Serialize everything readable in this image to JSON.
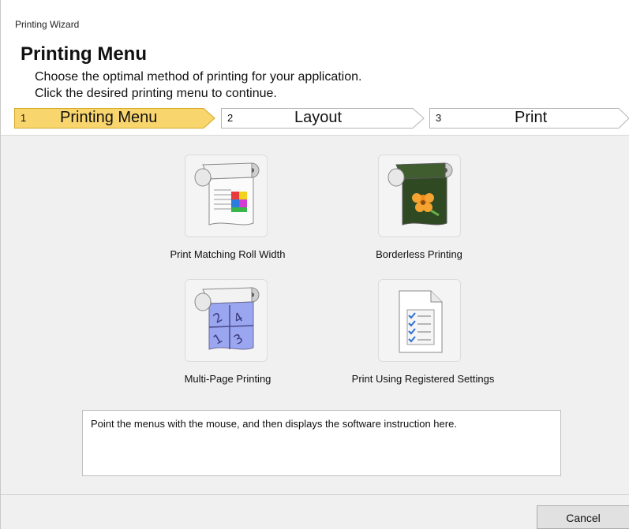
{
  "window": {
    "title": "Printing Wizard"
  },
  "header": {
    "heading": "Printing Menu",
    "desc_line1": "Choose the optimal method of printing for your application.",
    "desc_line2": "Click the desired printing menu to continue."
  },
  "steps": [
    {
      "number": "1",
      "label": "Printing Menu",
      "active": true
    },
    {
      "number": "2",
      "label": "Layout",
      "active": false
    },
    {
      "number": "3",
      "label": "Print",
      "active": false
    }
  ],
  "menu": [
    {
      "label": "Print Matching Roll Width",
      "icon": "roll-paper-color-icon"
    },
    {
      "label": "Borderless Printing",
      "icon": "roll-paper-borderless-icon"
    },
    {
      "label": "Multi-Page Printing",
      "icon": "roll-paper-multipage-icon"
    },
    {
      "label": "Print Using Registered Settings",
      "icon": "checklist-document-icon"
    }
  ],
  "info_text": "Point the menus with the mouse, and then displays the software instruction here.",
  "buttons": {
    "cancel": "Cancel"
  },
  "colors": {
    "active_step": "#f9d56e",
    "active_step_border": "#d4a827",
    "inactive_step_border": "#b4b4b4"
  }
}
